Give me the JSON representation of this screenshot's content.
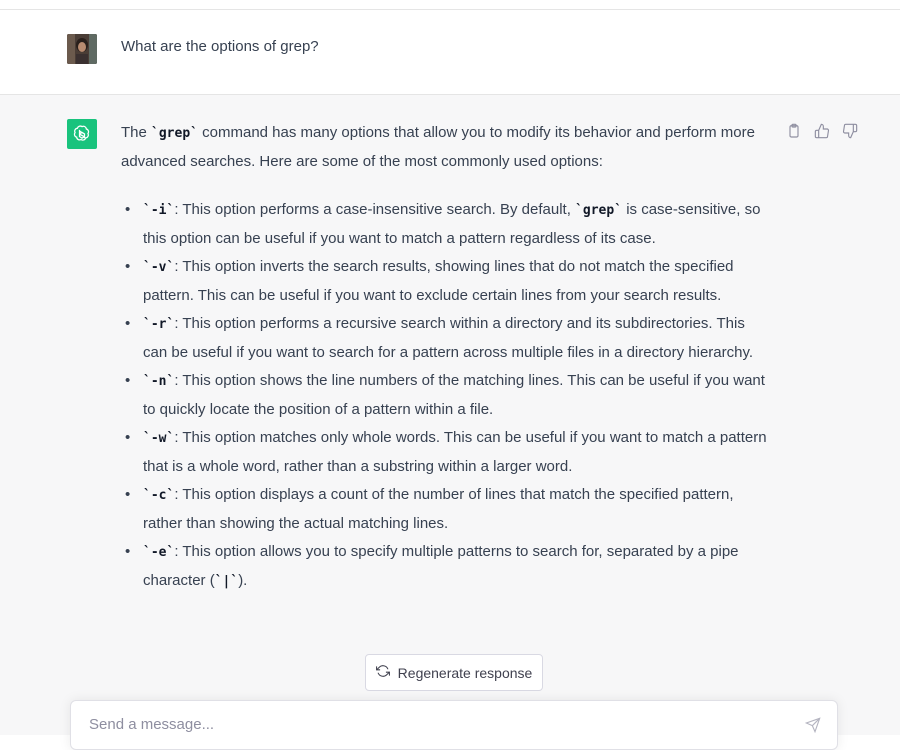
{
  "user_message": {
    "text": "What are the options of grep?"
  },
  "assistant_message": {
    "intro_before_code": "The ",
    "intro_code": "`grep`",
    "intro_after_code": " command has many options that allow you to modify its behavior and perform more advanced searches. Here are some of the most commonly used options:",
    "options": [
      {
        "code": "`-i`",
        "text": ": This option performs a case-insensitive search. By default, ",
        "code2": "`grep`",
        "text2": " is case-sensitive, so this option can be useful if you want to match a pattern regardless of its case."
      },
      {
        "code": "`-v`",
        "text": ": This option inverts the search results, showing lines that do not match the specified pattern. This can be useful if you want to exclude certain lines from your search results."
      },
      {
        "code": "`-r`",
        "text": ": This option performs a recursive search within a directory and its subdirectories. This can be useful if you want to search for a pattern across multiple files in a directory hierarchy."
      },
      {
        "code": "`-n`",
        "text": ": This option shows the line numbers of the matching lines. This can be useful if you want to quickly locate the position of a pattern within a file."
      },
      {
        "code": "`-w`",
        "text": ": This option matches only whole words. This can be useful if you want to match a pattern that is a whole word, rather than a substring within a larger word."
      },
      {
        "code": "`-c`",
        "text": ": This option displays a count of the number of lines that match the specified pattern, rather than showing the actual matching lines."
      },
      {
        "code": "`-e`",
        "text": ": This option allows you to specify multiple patterns to search for, separated by a pipe character (",
        "code2": "`|`",
        "text2": ")."
      }
    ]
  },
  "actions": {
    "icons": [
      "clipboard-icon",
      "thumbs-up-icon",
      "thumbs-down-icon"
    ]
  },
  "regenerate": {
    "label": "Regenerate response",
    "icon": "refresh-icon"
  },
  "composer": {
    "placeholder": "Send a message...",
    "send_icon": "send-icon"
  },
  "colors": {
    "assistant_bg": "#f7f7f8",
    "bot_avatar": "#19c37d",
    "text": "#374151"
  }
}
